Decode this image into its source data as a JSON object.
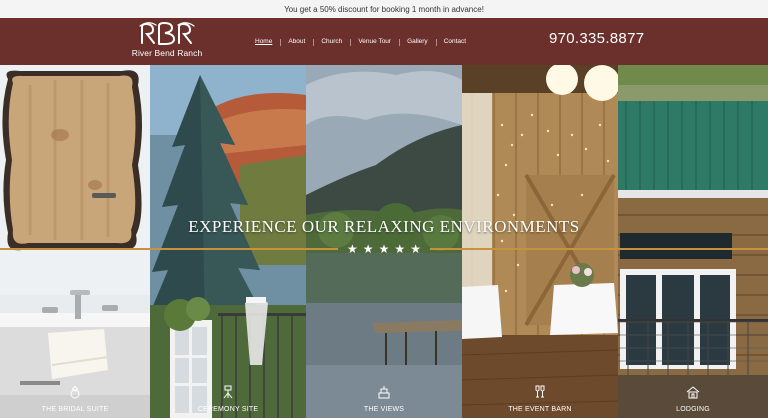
{
  "announcement": "You get a 50% discount for booking 1 month in advance!",
  "brand": {
    "logo_mark": "RBR",
    "name": "River Bend Ranch",
    "color": "#6b2f2c"
  },
  "nav": {
    "items": [
      "Home",
      "About",
      "Church",
      "Venue Tour",
      "Gallery",
      "Contact"
    ],
    "active": "Home"
  },
  "phone": "970.335.8877",
  "hero": {
    "headline": "EXPERIENCE OUR RELAXING ENVIRONMENTS",
    "stars": [
      "★",
      "★",
      "★",
      "★",
      "★"
    ],
    "accent_color": "#c8913b"
  },
  "panels": [
    {
      "label": "THE BRIDAL SUITE",
      "icon": "diamond-ring-icon"
    },
    {
      "label": "CEREMONY SITE",
      "icon": "camera-tripod-icon"
    },
    {
      "label": "THE VIEWS",
      "icon": "cake-icon"
    },
    {
      "label": "THE EVENT BARN",
      "icon": "champagne-glasses-icon"
    },
    {
      "label": "LODGING",
      "icon": "cottage-icon"
    }
  ]
}
